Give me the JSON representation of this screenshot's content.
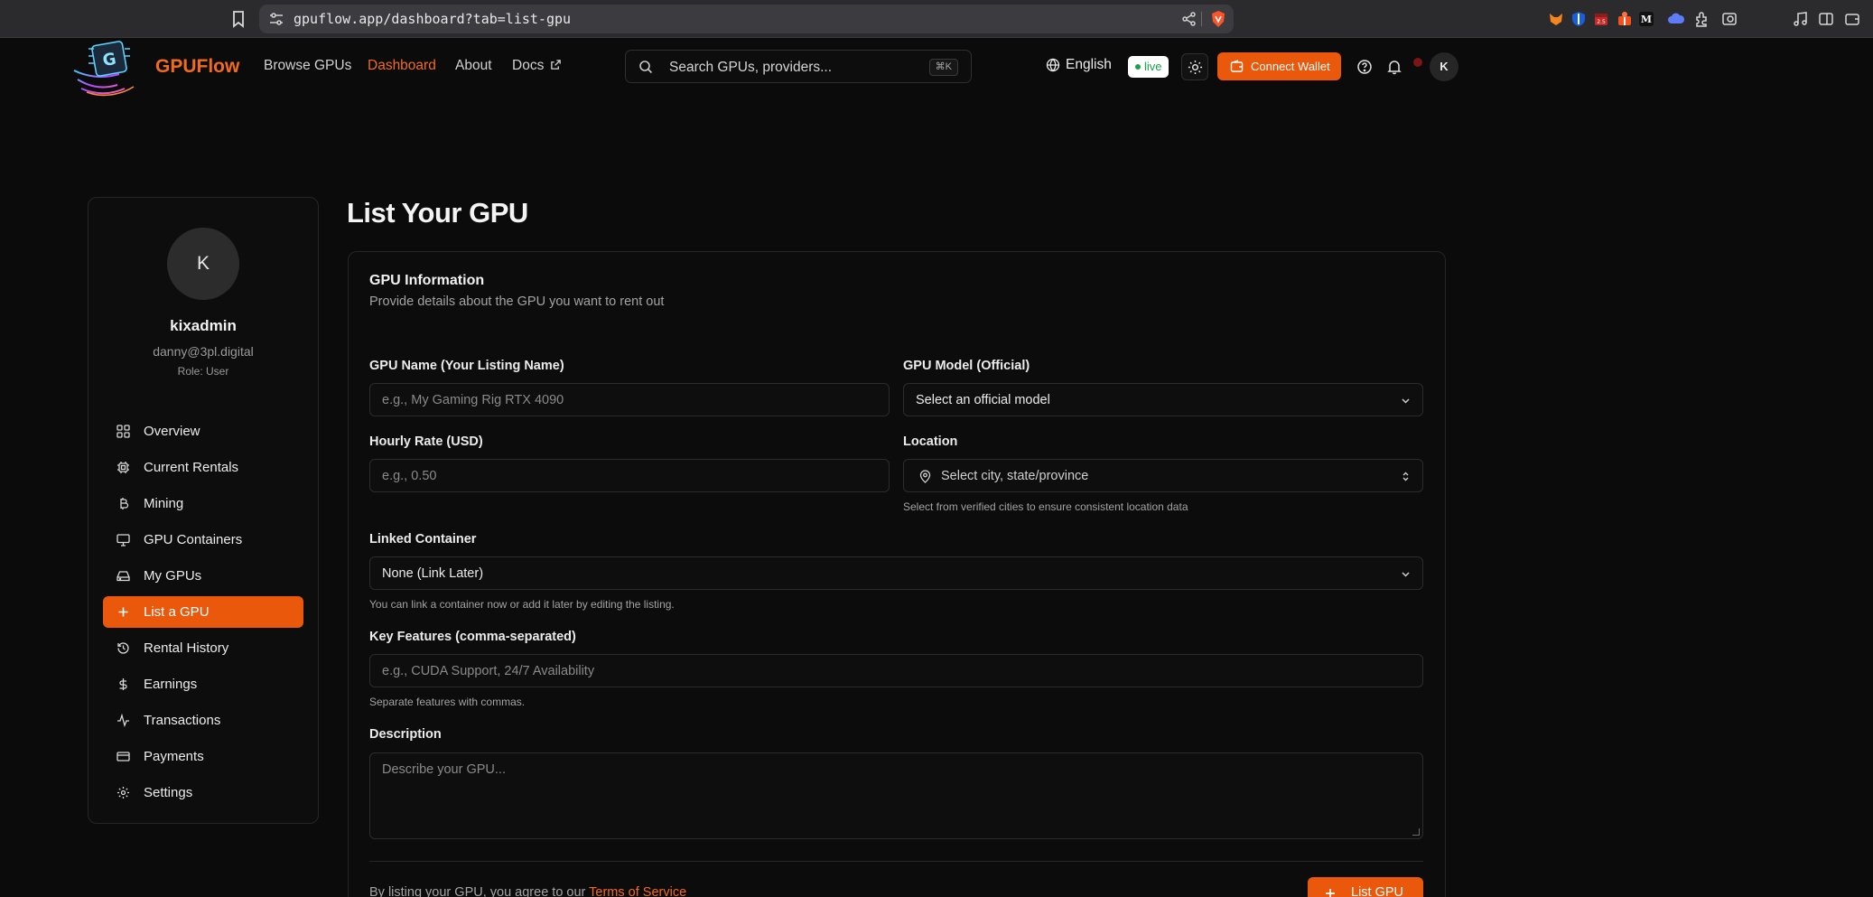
{
  "browser": {
    "url": "gpuflow.app/dashboard?tab=list-gpu"
  },
  "header": {
    "brand": "GPUFlow",
    "nav": [
      {
        "label": "Browse GPUs"
      },
      {
        "label": "Dashboard",
        "active": true
      },
      {
        "label": "About"
      },
      {
        "label": "Docs"
      }
    ],
    "search_placeholder": "Search GPUs, providers...",
    "search_shortcut": "⌘K",
    "language": "English",
    "status_badge": "live",
    "connect_wallet": "Connect Wallet",
    "avatar_initial": "K",
    "accent_color": "#ea580c"
  },
  "sidebar": {
    "avatar_initial": "K",
    "username": "kixadmin",
    "email": "danny@3pl.digital",
    "role": "Role: User",
    "items": [
      {
        "label": "Overview",
        "icon": "grid-icon"
      },
      {
        "label": "Current Rentals",
        "icon": "chip-icon"
      },
      {
        "label": "Mining",
        "icon": "bitcoin-icon"
      },
      {
        "label": "GPU Containers",
        "icon": "monitor-icon"
      },
      {
        "label": "My GPUs",
        "icon": "hard-drive-icon"
      },
      {
        "label": "List a GPU",
        "icon": "plus-icon",
        "active": true
      },
      {
        "label": "Rental History",
        "icon": "history-icon"
      },
      {
        "label": "Earnings",
        "icon": "dollar-icon"
      },
      {
        "label": "Transactions",
        "icon": "activity-icon"
      },
      {
        "label": "Payments",
        "icon": "credit-card-icon"
      },
      {
        "label": "Settings",
        "icon": "gear-icon"
      }
    ]
  },
  "main": {
    "title": "List Your GPU",
    "card_title": "GPU Information",
    "card_subtitle": "Provide details about the GPU you want to rent out",
    "form": {
      "gpu_name_label": "GPU Name (Your Listing Name)",
      "gpu_name_placeholder": "e.g., My Gaming Rig RTX 4090",
      "gpu_model_label": "GPU Model (Official)",
      "gpu_model_value": "Select an official model",
      "hourly_rate_label": "Hourly Rate (USD)",
      "hourly_rate_placeholder": "e.g., 0.50",
      "location_label": "Location",
      "location_value": "Select city, state/province",
      "location_hint": "Select from verified cities to ensure consistent location data",
      "linked_container_label": "Linked Container",
      "linked_container_value": "None (Link Later)",
      "linked_container_hint": "You can link a container now or add it later by editing the listing.",
      "key_features_label": "Key Features (comma-separated)",
      "key_features_placeholder": "e.g., CUDA Support, 24/7 Availability",
      "key_features_hint": "Separate features with commas.",
      "description_label": "Description",
      "description_placeholder": "Describe your GPU..."
    },
    "terms_prefix": "By listing your GPU, you agree to our",
    "terms_link": "Terms of Service",
    "submit_label": "List GPU"
  }
}
